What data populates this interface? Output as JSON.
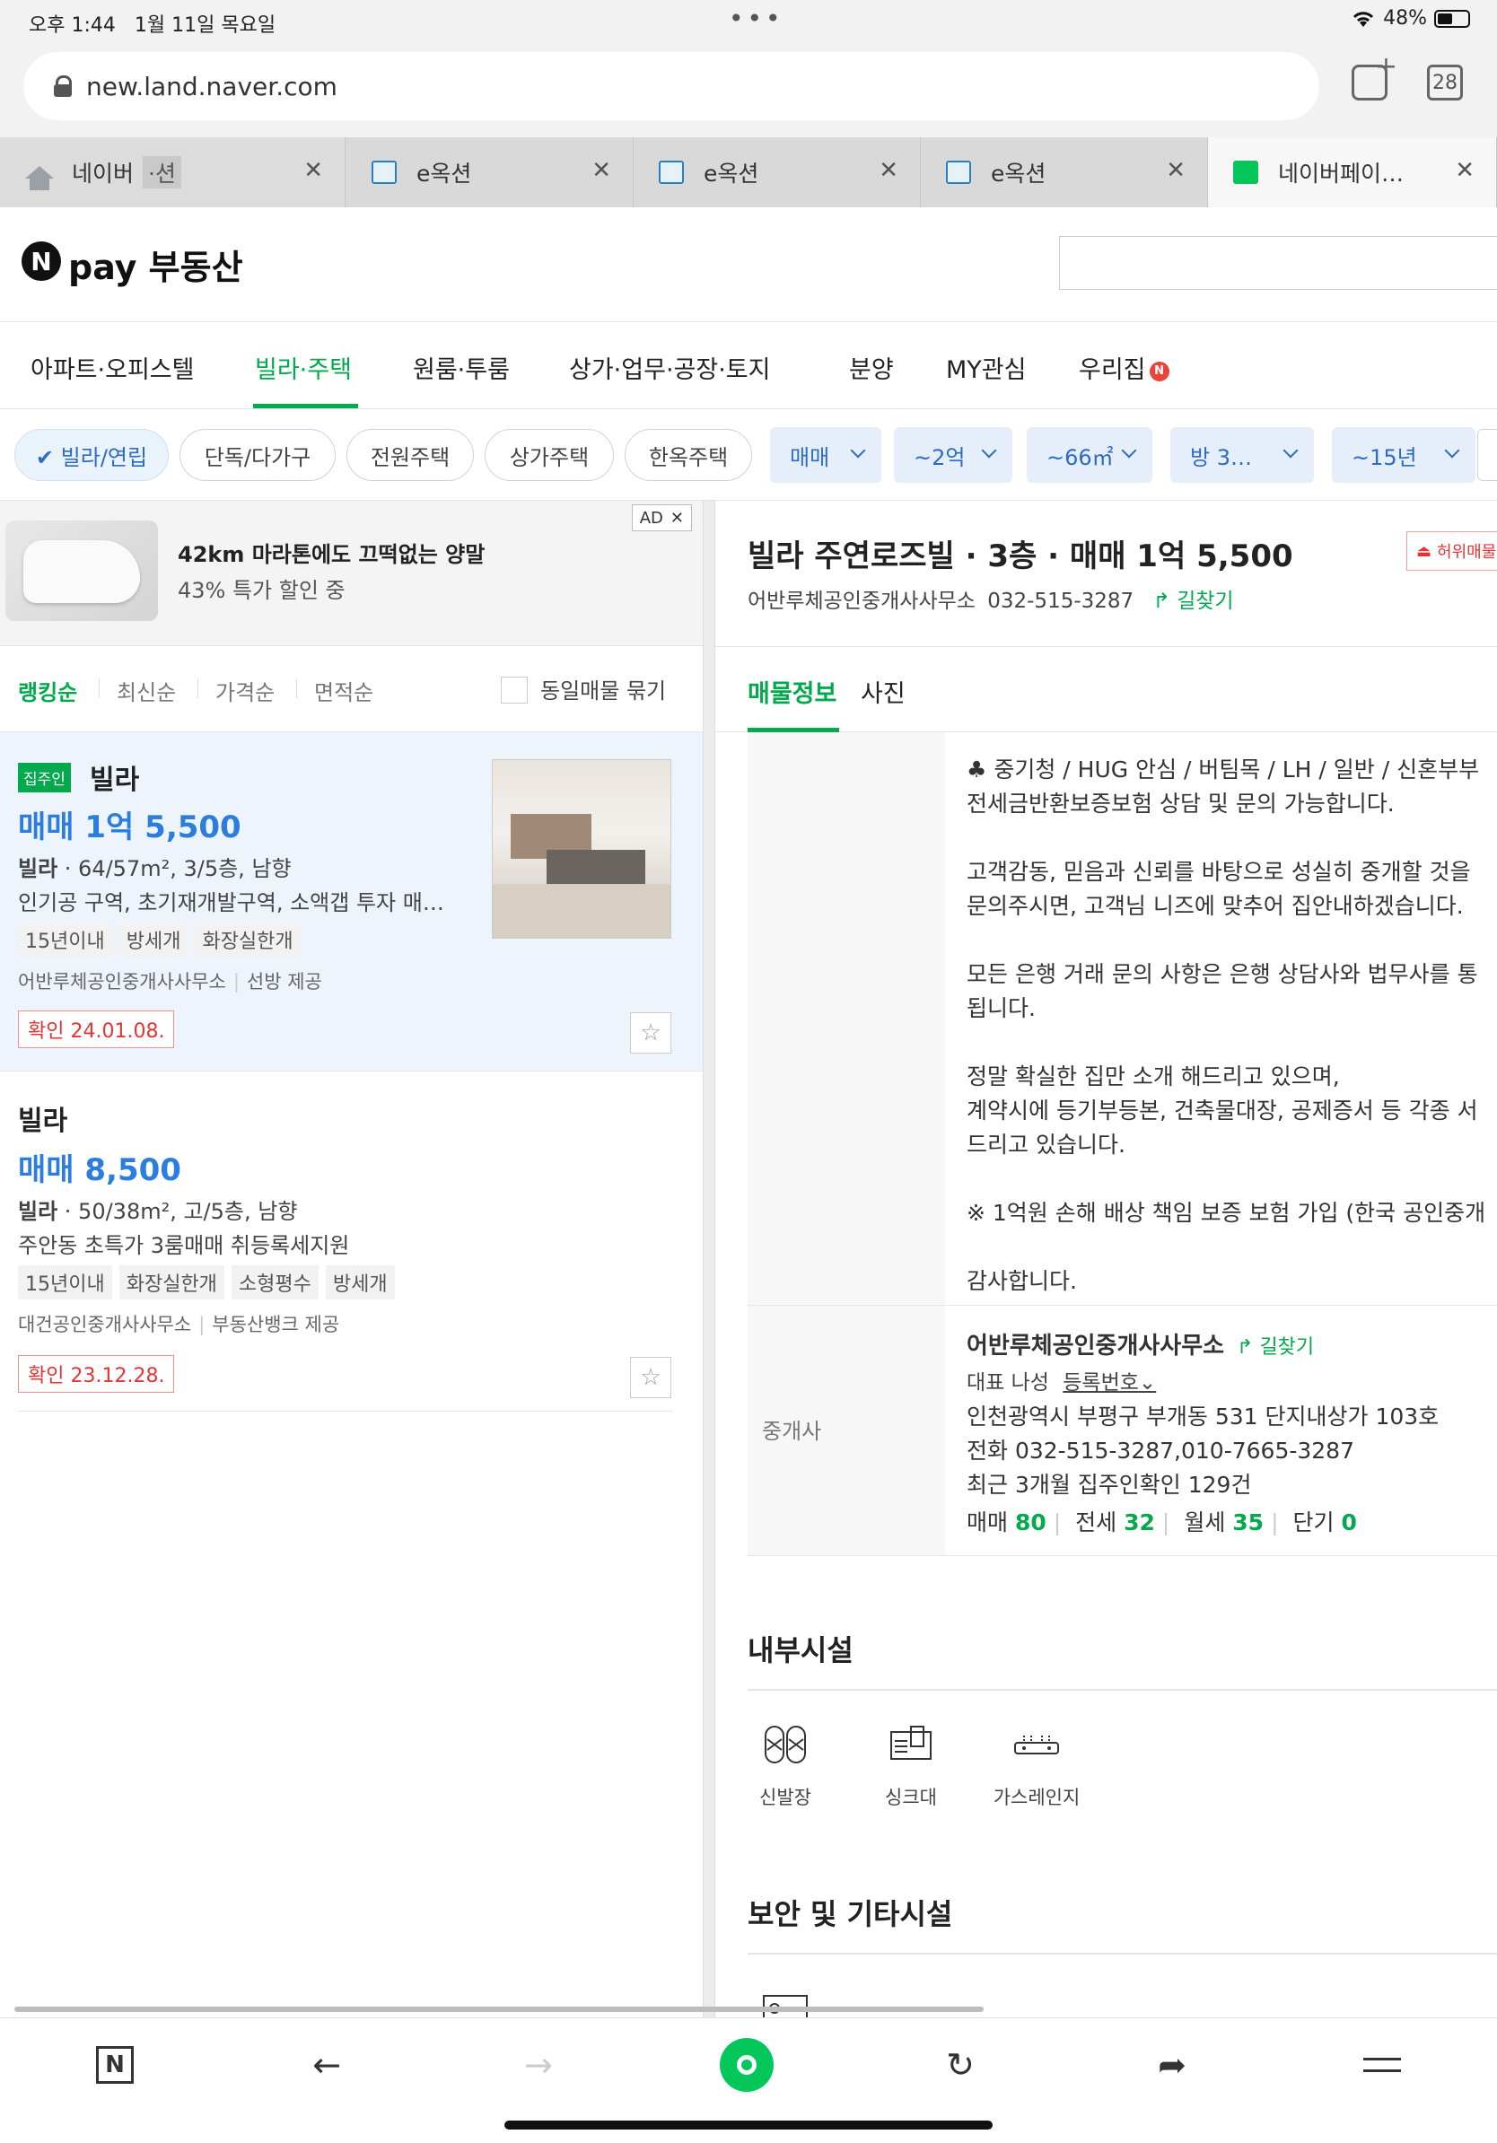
{
  "status": {
    "time": "오후 1:44",
    "date": "1월 11일 목요일",
    "battery": "48%"
  },
  "browser": {
    "url": "new.land.naver.com",
    "tab_count": "28",
    "tabs": [
      {
        "label": "네이버",
        "extra": "·션",
        "icon_color": "#9aa0a6"
      },
      {
        "label": "e옥션",
        "icon_color": "#2a7fc1"
      },
      {
        "label": "e옥션",
        "icon_color": "#2a7fc1"
      },
      {
        "label": "e옥션",
        "icon_color": "#2a7fc1"
      },
      {
        "label": "네이버페이…",
        "icon_color": "#03c75a"
      }
    ]
  },
  "header": {
    "logo_n": "N",
    "logo_text": "pay 부동산"
  },
  "nav": [
    {
      "label": "아파트·오피스텔"
    },
    {
      "label": "빌라·주택"
    },
    {
      "label": "원룸·투룸"
    },
    {
      "label": "상가·업무·공장·토지"
    },
    {
      "label": "분양"
    },
    {
      "label": "MY관심"
    },
    {
      "label": "우리집",
      "badge": "N"
    }
  ],
  "filters": {
    "chips": [
      "✔ 빌라/연립",
      "단독/다가구",
      "전원주택",
      "상가주택",
      "한옥주택"
    ],
    "dropdowns": [
      "매매",
      "~2억",
      "~66㎡",
      "방 3…",
      "~15년"
    ]
  },
  "ad": {
    "title": "42km 마라톤에도 끄떡없는 양말",
    "subtitle": "43% 특가 할인 중",
    "badge": "AD"
  },
  "sort": {
    "options": [
      "랭킹순",
      "최신순",
      "가격순",
      "면적순"
    ],
    "group_label": "동일매물 묶기"
  },
  "listings": [
    {
      "owner_badge": "집주인",
      "type": "빌라",
      "price": "매매 1억 5,500",
      "spec_bold": "빌라",
      "spec": " · 64/57m², 3/5층, 남향",
      "desc": "인기공 구역, 초기재개발구역, 소액갭 투자 매…",
      "tags": [
        "15년이내",
        "방세개",
        "화장실한개"
      ],
      "agent": "어반루체공인중개사사무소",
      "provider": "선방 제공",
      "confirm": "확인 24.01.08."
    },
    {
      "type": "빌라",
      "price": "매매 8,500",
      "spec_bold": "빌라",
      "spec": " · 50/38m², 고/5층, 남향",
      "desc": "주안동 초특가 3룸매매 취등록세지원",
      "tags": [
        "15년이내",
        "화장실한개",
        "소형평수",
        "방세개"
      ],
      "agent": "대건공인중개사사무소",
      "provider": "부동산뱅크 제공",
      "confirm": "확인 23.12.28."
    }
  ],
  "detail": {
    "title": "빌라 주연로즈빌 · 3층 · 매매 1억 5,500",
    "agent": "어반루체공인중개사사무소",
    "phone": "032-515-3287",
    "directions": "길찾기",
    "report": "허위매물",
    "tabs": [
      "매물정보",
      "사진"
    ],
    "desc_lines": [
      "♣ 중기청 / HUG 안심 / 버팀목 / LH / 일반 / 신혼부부",
      "전세금반환보증보험 상담 및 문의 가능합니다.",
      "",
      "고객감동, 믿음과 신뢰를 바탕으로 성실히 중개할 것을",
      "문의주시면, 고객님 니즈에 맞추어 집안내하겠습니다.",
      "",
      "모든 은행 거래 문의 사항은 은행 상담사와 법무사를 통",
      "됩니다.",
      "",
      "정말 확실한 집만 소개 해드리고 있으며,",
      "계약시에 등기부등본, 건축물대장, 공제증서 등 각종 서",
      "드리고 있습니다.",
      "",
      "※ 1억원 손해 배상 책임 보증 보험 가입 (한국 공인중개",
      "",
      "감사합니다."
    ],
    "broker": {
      "label": "중개사",
      "name": "어반루체공인중개사사무소",
      "directions": "길찾기",
      "rep": "대표 나성",
      "reg": "등록번호",
      "address": "인천광역시 부평구 부개동 531 단지내상가 103호",
      "phone": "전화 032-515-3287,010-7665-3287",
      "verified": "최근 3개월 집주인확인 129건",
      "counts": [
        {
          "label": "매매",
          "value": "80"
        },
        {
          "label": "전세",
          "value": "32"
        },
        {
          "label": "월세",
          "value": "35"
        },
        {
          "label": "단기",
          "value": "0"
        }
      ]
    },
    "facilities_title": "내부시설",
    "facilities": [
      "신발장",
      "싱크대",
      "가스레인지"
    ],
    "security_title": "보안 및 기타시설"
  },
  "colors": {
    "accent": "#03a94d",
    "price_blue": "#2b7de0",
    "filter_blue": "#2b6cc4"
  }
}
